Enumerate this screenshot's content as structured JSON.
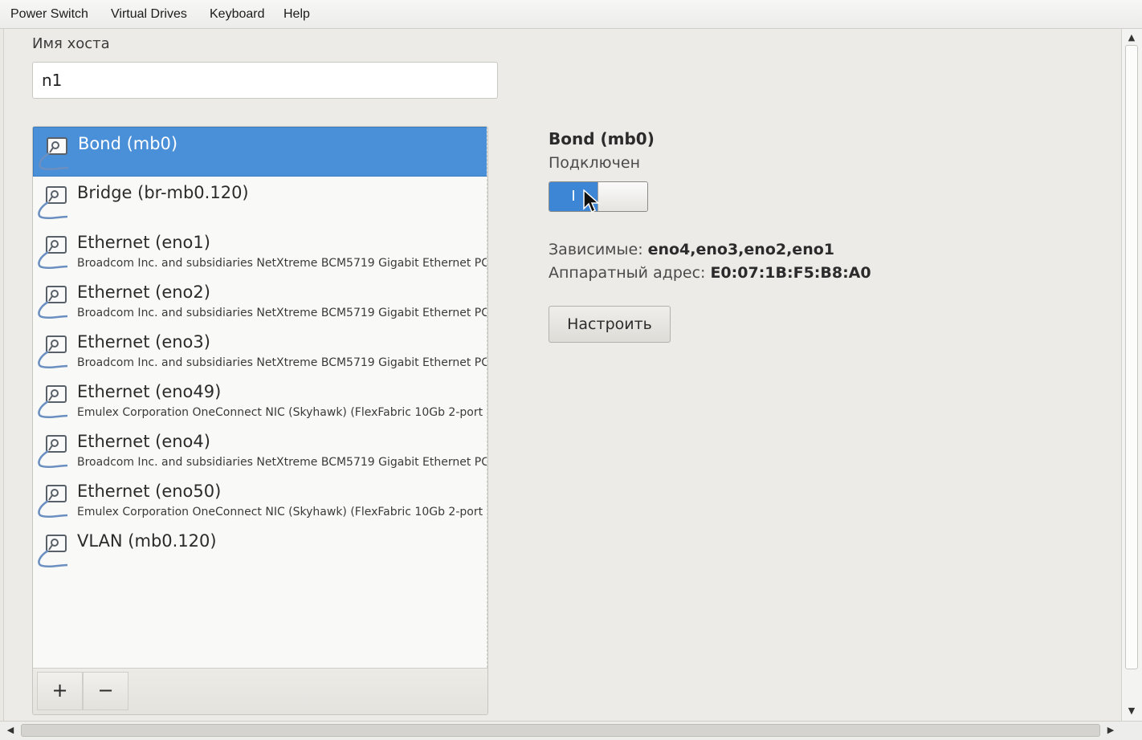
{
  "menubar": {
    "items": [
      "Power Switch",
      "Virtual Drives",
      "Keyboard",
      "Help"
    ]
  },
  "host": {
    "label": "Имя хоста",
    "value": "n1"
  },
  "connections": [
    {
      "title": "Bond (mb0)",
      "subtitle": "",
      "selected": true
    },
    {
      "title": "Bridge (br-mb0.120)",
      "subtitle": ""
    },
    {
      "title": "Ethernet (eno1)",
      "subtitle": "Broadcom Inc. and subsidiaries NetXtreme BCM5719 Gigabit Ethernet PC"
    },
    {
      "title": "Ethernet (eno2)",
      "subtitle": "Broadcom Inc. and subsidiaries NetXtreme BCM5719 Gigabit Ethernet PC"
    },
    {
      "title": "Ethernet (eno3)",
      "subtitle": "Broadcom Inc. and subsidiaries NetXtreme BCM5719 Gigabit Ethernet PC"
    },
    {
      "title": "Ethernet (eno49)",
      "subtitle": "Emulex Corporation OneConnect NIC (Skyhawk) (FlexFabric 10Gb 2-port"
    },
    {
      "title": "Ethernet (eno4)",
      "subtitle": "Broadcom Inc. and subsidiaries NetXtreme BCM5719 Gigabit Ethernet PC"
    },
    {
      "title": "Ethernet (eno50)",
      "subtitle": "Emulex Corporation OneConnect NIC (Skyhawk) (FlexFabric 10Gb 2-port"
    },
    {
      "title": "VLAN (mb0.120)",
      "subtitle": ""
    }
  ],
  "list_toolbar": {
    "add_label": "+",
    "remove_label": "−"
  },
  "detail": {
    "title": "Bond (mb0)",
    "status": "Подключен",
    "toggle_on_label": "I",
    "toggle_state": "on",
    "dependents_label": "Зависимые:",
    "dependents_value": "eno4,eno3,eno2,eno1",
    "hw_address_label": "Аппаратный адрес:",
    "hw_address_value": "E0:07:1B:F5:B8:A0",
    "configure_label": "Настроить"
  },
  "colors": {
    "selection": "#4a90d9",
    "toggle_on": "#3d86d6",
    "window_bg": "#ecebe7"
  },
  "icons": {
    "connection": "network-wired-icon",
    "cursor": "mouse-pointer-icon"
  }
}
